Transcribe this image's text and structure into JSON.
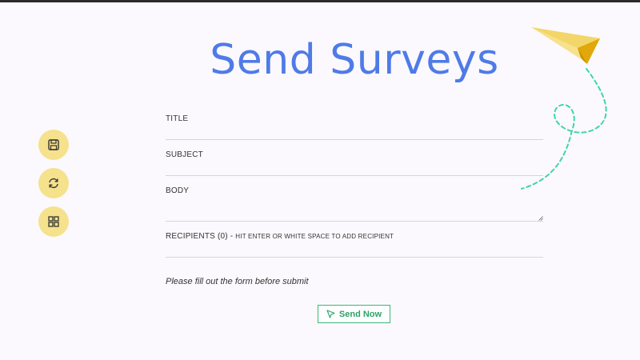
{
  "header": {
    "title": "Send Surveys"
  },
  "side_actions": {
    "icons": [
      "save-icon",
      "refresh-icon",
      "grid-icon"
    ],
    "color": "#f6e18c"
  },
  "form": {
    "title_label": "TITLE",
    "title_value": "",
    "subject_label": "SUBJECT",
    "subject_value": "",
    "body_label": "BODY",
    "body_value": "",
    "recipients_label": "RECIPIENTS (0) - ",
    "recipients_hint": "HIT ENTER OR WHITE SPACE TO ADD RECIPIENT",
    "recipients_value": ""
  },
  "status": {
    "message": "Please fill out the form before submit"
  },
  "actions": {
    "send_label": "Send Now",
    "send_icon": "cursor-arrow-icon",
    "send_color": "#3cb878"
  },
  "decoration": {
    "icon": "paper-plane-icon",
    "plane_color": "#f6e18c",
    "trail_color": "#3fd6a8"
  },
  "colors": {
    "title": "#4f7be8",
    "background": "#fbf9fd"
  }
}
